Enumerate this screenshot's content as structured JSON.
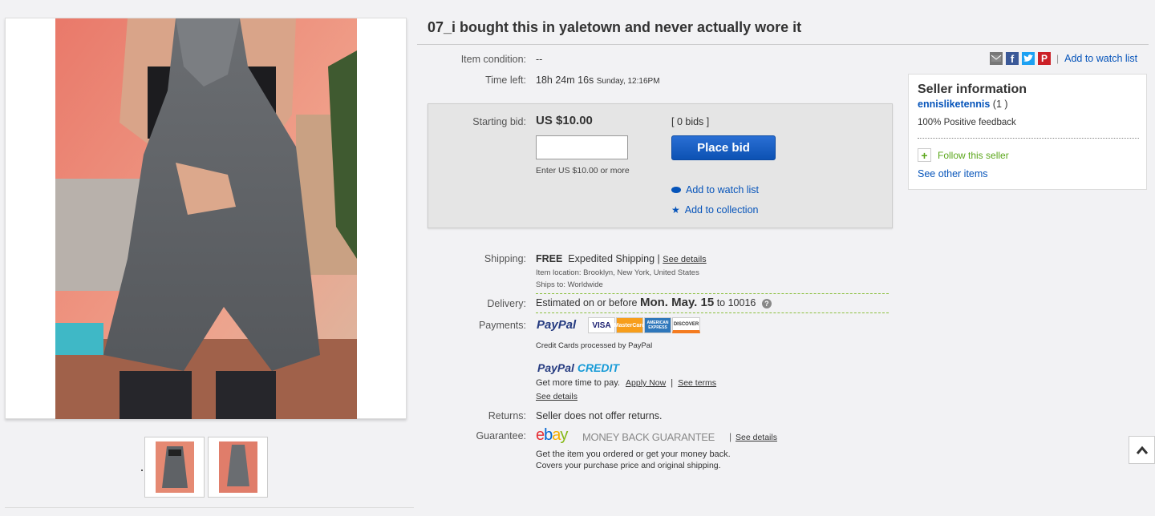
{
  "title": "07_i bought this in yaletown and never actually wore it",
  "item_condition": {
    "label": "Item condition:",
    "value": "--"
  },
  "time_left": {
    "label": "Time left:",
    "value": "18h 24m 16s",
    "end": "Sunday, 12:16PM"
  },
  "share": {
    "watch_link": "Add to watch list"
  },
  "bid": {
    "label": "Starting bid:",
    "price": "US $10.00",
    "bids": "[ 0 bids ]",
    "hint": "Enter US $10.00 or more",
    "button": "Place bid",
    "watch": "Add to watch list",
    "collection": "Add to collection"
  },
  "seller": {
    "title": "Seller information",
    "name": "ennisliketennis",
    "score": "(1 )",
    "feedback": "100% Positive feedback",
    "follow": "Follow this seller",
    "other": "See other items"
  },
  "shipping": {
    "label": "Shipping:",
    "free": "FREE",
    "method": "Expedited Shipping",
    "sep": "|",
    "details": "See details",
    "location": "Item location:  Brooklyn, New York, United States",
    "ships_to": "Ships to:  Worldwide"
  },
  "delivery": {
    "label": "Delivery:",
    "prefix": "Estimated on or before",
    "date": "Mon. May. 15",
    "suffix": "to 10016"
  },
  "payments": {
    "label": "Payments:",
    "paypal": "PayPal",
    "cards": [
      "VISA",
      "MasterCard",
      "AMERICAN EXPRESS",
      "DISCOVER"
    ],
    "card_note": "Credit Cards processed by PayPal",
    "credit_paypal": "PayPal",
    "credit_word": "CREDIT",
    "credit_note": "Get more time to pay.",
    "apply": "Apply Now",
    "sep": "|",
    "terms": "See terms",
    "details": "See details"
  },
  "returns": {
    "label": "Returns:",
    "value": "Seller does not offer returns."
  },
  "guarantee": {
    "label": "Guarantee:",
    "logo_letters": [
      "e",
      "b",
      "a",
      "y"
    ],
    "text": "MONEY BACK GUARANTEE",
    "sep": "|",
    "details": "See details",
    "line1": "Get the item you ordered or get your money back.",
    "line2": "Covers your purchase price and original shipping."
  },
  "colors": {
    "link": "#0654ba",
    "button": "#0d52b3",
    "background": "#f2f2f4"
  }
}
